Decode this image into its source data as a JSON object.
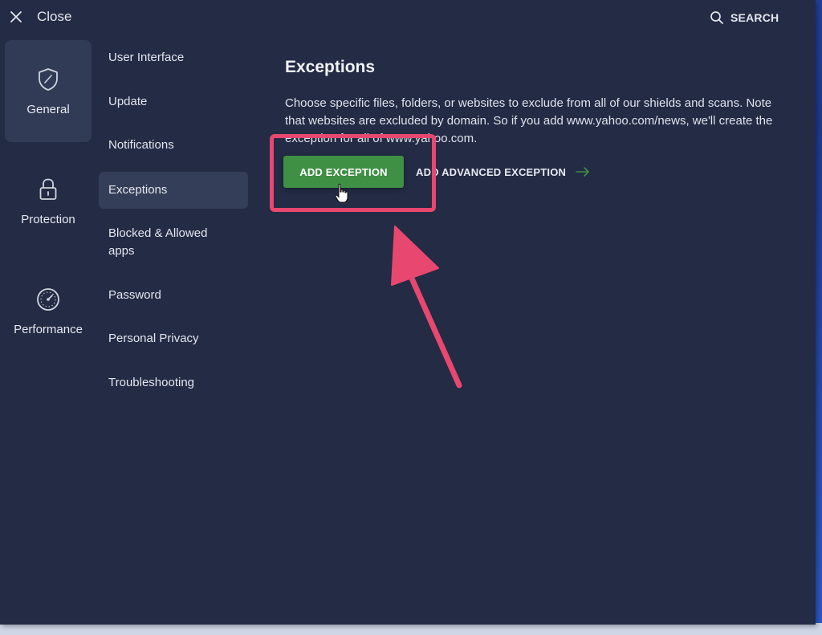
{
  "header": {
    "close_label": "Close",
    "search_label": "SEARCH"
  },
  "categories": [
    {
      "label": "General",
      "icon": "shield-icon",
      "active": true
    },
    {
      "label": "Protection",
      "icon": "lock-icon",
      "active": false
    },
    {
      "label": "Performance",
      "icon": "speedometer-icon",
      "active": false
    }
  ],
  "subnav": [
    {
      "label": "User Interface"
    },
    {
      "label": "Update"
    },
    {
      "label": "Notifications"
    },
    {
      "label": "Exceptions",
      "active": true
    },
    {
      "label": "Blocked & Allowed apps"
    },
    {
      "label": "Password"
    },
    {
      "label": "Personal Privacy"
    },
    {
      "label": "Troubleshooting"
    }
  ],
  "content": {
    "title": "Exceptions",
    "description": "Choose specific files, folders, or websites to exclude from all of our shields and scans. Note that websites are excluded by domain. So if you add www.yahoo.com/news, we'll create the exception for all of www.yahoo.com.",
    "add_exception_label": "ADD EXCEPTION",
    "add_advanced_label": "ADD ADVANCED EXCEPTION"
  },
  "colors": {
    "window_bg": "#232b45",
    "accent_green": "#3f8f45",
    "annotation_pink": "#e8476f"
  }
}
